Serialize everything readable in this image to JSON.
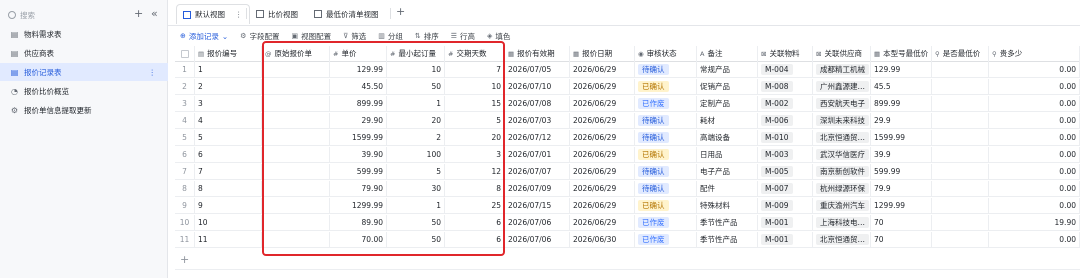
{
  "sidebar": {
    "search_placeholder": "搜索",
    "add_label": "+",
    "collapse_label": "«",
    "more_label": "⋮",
    "items": [
      {
        "label": "物料需求表",
        "icon": "table-icon",
        "active": false
      },
      {
        "label": "供应商表",
        "icon": "table-icon",
        "active": false
      },
      {
        "label": "报价记录表",
        "icon": "table-icon",
        "active": true
      },
      {
        "label": "报价比价概览",
        "icon": "dashboard-icon",
        "active": false
      },
      {
        "label": "报价单信息提取更新",
        "icon": "automation-icon",
        "active": false
      }
    ]
  },
  "tabs": [
    {
      "label": "默认视图",
      "active": true,
      "more": "⋮"
    },
    {
      "label": "比价视图",
      "active": false
    },
    {
      "label": "最低价清单视图",
      "active": false
    }
  ],
  "add_tab_label": "+",
  "toolbar": [
    {
      "label": "添加记录",
      "icon": "plus-icon",
      "primary": true,
      "caret": "⌄"
    },
    {
      "label": "字段配置",
      "icon": "gear-icon"
    },
    {
      "label": "视图配置",
      "icon": "view-icon"
    },
    {
      "label": "筛选",
      "icon": "filter-icon"
    },
    {
      "label": "分组",
      "icon": "group-icon"
    },
    {
      "label": "排序",
      "icon": "sort-icon"
    },
    {
      "label": "行高",
      "icon": "row-height-icon"
    },
    {
      "label": "填色",
      "icon": "paint-icon"
    }
  ],
  "columns": [
    {
      "label": "报价编号",
      "icon": "▤"
    },
    {
      "label": "原始报价单",
      "icon": "@"
    },
    {
      "label": "单价",
      "icon": "#"
    },
    {
      "label": "最小起订量",
      "icon": "#"
    },
    {
      "label": "交期天数",
      "icon": "#"
    },
    {
      "label": "报价有效期",
      "icon": "▦"
    },
    {
      "label": "报价日期",
      "icon": "▦"
    },
    {
      "label": "审核状态",
      "icon": "◉"
    },
    {
      "label": "备注",
      "icon": "A"
    },
    {
      "label": "关联物料",
      "icon": "⊠"
    },
    {
      "label": "关联供应商",
      "icon": "⊠"
    },
    {
      "label": "本型号最低价",
      "icon": "▦"
    },
    {
      "label": "是否最低价",
      "icon": "⚲"
    },
    {
      "label": "贵多少",
      "icon": "⚲"
    }
  ],
  "rows": [
    {
      "idx": "1",
      "id": "1",
      "price": "129.99",
      "moq": "10",
      "days": "7",
      "valid": "2026/07/05",
      "date": "2026/06/29",
      "status": "待确认",
      "note": "常规产品",
      "material": "M-004",
      "supplier": "成都精工机械",
      "lowest": "129.99",
      "is_lowest": "",
      "diff": "0.00"
    },
    {
      "idx": "2",
      "id": "2",
      "price": "45.50",
      "moq": "50",
      "days": "10",
      "valid": "2026/07/10",
      "date": "2026/06/29",
      "status": "已确认",
      "note": "促销产品",
      "material": "M-008",
      "supplier": "广州鑫源建…",
      "lowest": "45.5",
      "is_lowest": "",
      "diff": "0.00"
    },
    {
      "idx": "3",
      "id": "3",
      "price": "899.99",
      "moq": "1",
      "days": "15",
      "valid": "2026/07/08",
      "date": "2026/06/29",
      "status": "已作废",
      "note": "定制产品",
      "material": "M-002",
      "supplier": "西安航天电子",
      "lowest": "899.99",
      "is_lowest": "",
      "diff": "0.00"
    },
    {
      "idx": "4",
      "id": "4",
      "price": "29.90",
      "moq": "20",
      "days": "5",
      "valid": "2026/07/03",
      "date": "2026/06/29",
      "status": "待确认",
      "note": "耗材",
      "material": "M-006",
      "supplier": "深圳未来科技",
      "lowest": "29.9",
      "is_lowest": "",
      "diff": "0.00"
    },
    {
      "idx": "5",
      "id": "5",
      "price": "1599.99",
      "moq": "2",
      "days": "20",
      "valid": "2026/07/12",
      "date": "2026/06/29",
      "status": "待确认",
      "note": "高端设备",
      "material": "M-010",
      "supplier": "北京恒通贸…",
      "lowest": "1599.99",
      "is_lowest": "",
      "diff": "0.00"
    },
    {
      "idx": "6",
      "id": "6",
      "price": "39.90",
      "moq": "100",
      "days": "3",
      "valid": "2026/07/01",
      "date": "2026/06/29",
      "status": "已确认",
      "note": "日用品",
      "material": "M-003",
      "supplier": "武汉华信医疗",
      "lowest": "39.9",
      "is_lowest": "",
      "diff": "0.00"
    },
    {
      "idx": "7",
      "id": "7",
      "price": "599.99",
      "moq": "5",
      "days": "12",
      "valid": "2026/07/07",
      "date": "2026/06/29",
      "status": "待确认",
      "note": "电子产品",
      "material": "M-005",
      "supplier": "南京新创软件",
      "lowest": "599.99",
      "is_lowest": "",
      "diff": "0.00"
    },
    {
      "idx": "8",
      "id": "8",
      "price": "79.90",
      "moq": "30",
      "days": "8",
      "valid": "2026/07/09",
      "date": "2026/06/29",
      "status": "待确认",
      "note": "配件",
      "material": "M-007",
      "supplier": "杭州绿源环保",
      "lowest": "79.9",
      "is_lowest": "",
      "diff": "0.00"
    },
    {
      "idx": "9",
      "id": "9",
      "price": "1299.99",
      "moq": "1",
      "days": "25",
      "valid": "2026/07/15",
      "date": "2026/06/29",
      "status": "已确认",
      "note": "特殊材料",
      "material": "M-009",
      "supplier": "重庆渝州汽车",
      "lowest": "1299.99",
      "is_lowest": "",
      "diff": "0.00"
    },
    {
      "idx": "10",
      "id": "10",
      "price": "89.90",
      "moq": "50",
      "days": "6",
      "valid": "2026/07/06",
      "date": "2026/06/29",
      "status": "已作废",
      "note": "季节性产品",
      "material": "M-001",
      "supplier": "上海科技电…",
      "lowest": "70",
      "is_lowest": "",
      "diff": "19.90"
    },
    {
      "idx": "11",
      "id": "11",
      "price": "70.00",
      "moq": "50",
      "days": "6",
      "valid": "2026/07/06",
      "date": "2026/06/30",
      "status": "已作废",
      "note": "季节性产品",
      "material": "M-001",
      "supplier": "北京恒通贸…",
      "lowest": "70",
      "is_lowest": "",
      "diff": "0.00"
    }
  ],
  "add_row_label": "+",
  "status_colors": {
    "待确认": {
      "bg": "#e1eaff",
      "fg": "#245bdb"
    },
    "已确认": {
      "bg": "#fff3cc",
      "fg": "#b37400"
    },
    "已作废": {
      "bg": "#e1eaff",
      "fg": "#3370ff"
    }
  },
  "highlight_color": "#e0262b"
}
